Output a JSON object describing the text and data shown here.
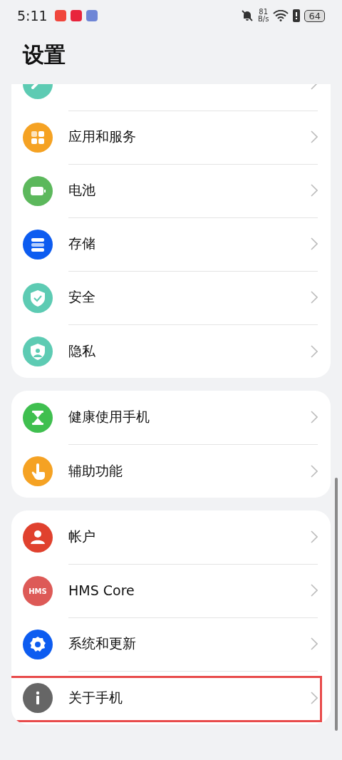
{
  "status_bar": {
    "time": "5:11",
    "net_speed": "81",
    "net_unit": "B/s",
    "battery": "64"
  },
  "title": "设置",
  "groups": [
    {
      "items": [
        {
          "kind": "biometrics",
          "color": "#5dcbb3",
          "cut": true,
          "highlighted": false
        },
        {
          "kind": "apps",
          "label": "应用和服务",
          "color": "#f5a223",
          "highlighted": false
        },
        {
          "kind": "battery",
          "label": "电池",
          "color": "#5cb85c",
          "highlighted": false
        },
        {
          "kind": "storage",
          "label": "存储",
          "color": "#0d5cf0",
          "highlighted": false
        },
        {
          "kind": "security",
          "label": "安全",
          "color": "#5dcbb3",
          "highlighted": false
        },
        {
          "kind": "privacy",
          "label": "隐私",
          "color": "#5dcbb3",
          "highlighted": false
        }
      ]
    },
    {
      "items": [
        {
          "kind": "hourglass",
          "label": "健康使用手机",
          "color": "#3fbf4f",
          "highlighted": false
        },
        {
          "kind": "hand",
          "label": "辅助功能",
          "color": "#f5a223",
          "highlighted": false
        }
      ]
    },
    {
      "items": [
        {
          "kind": "account",
          "label": "帐户",
          "color": "#e0412e",
          "highlighted": false
        },
        {
          "kind": "hms",
          "label": "HMS Core",
          "badge": "HMS",
          "color": "#dd5a57",
          "highlighted": false
        },
        {
          "kind": "gear",
          "label": "系统和更新",
          "color": "#0d5cf0",
          "highlighted": false
        },
        {
          "kind": "info",
          "label": "关于手机",
          "color": "#666666",
          "highlighted": true
        }
      ]
    }
  ]
}
